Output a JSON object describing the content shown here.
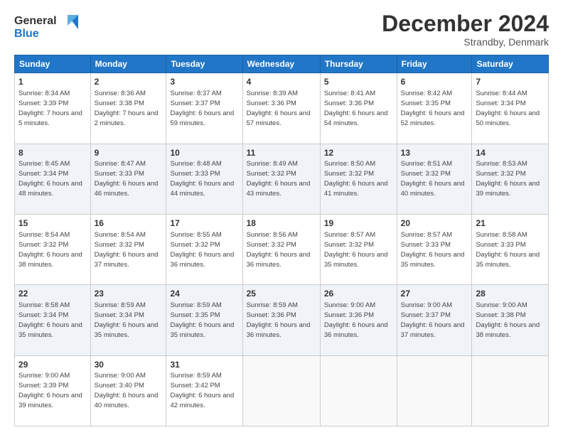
{
  "logo": {
    "line1": "General",
    "line2": "Blue",
    "icon_color": "#2176c7"
  },
  "header": {
    "month": "December 2024",
    "location": "Strandby, Denmark"
  },
  "columns": [
    "Sunday",
    "Monday",
    "Tuesday",
    "Wednesday",
    "Thursday",
    "Friday",
    "Saturday"
  ],
  "weeks": [
    [
      {
        "day": "1",
        "sunrise": "8:34 AM",
        "sunset": "3:39 PM",
        "daylight": "7 hours and 5 minutes."
      },
      {
        "day": "2",
        "sunrise": "8:36 AM",
        "sunset": "3:38 PM",
        "daylight": "7 hours and 2 minutes."
      },
      {
        "day": "3",
        "sunrise": "8:37 AM",
        "sunset": "3:37 PM",
        "daylight": "6 hours and 59 minutes."
      },
      {
        "day": "4",
        "sunrise": "8:39 AM",
        "sunset": "3:36 PM",
        "daylight": "6 hours and 57 minutes."
      },
      {
        "day": "5",
        "sunrise": "8:41 AM",
        "sunset": "3:36 PM",
        "daylight": "6 hours and 54 minutes."
      },
      {
        "day": "6",
        "sunrise": "8:42 AM",
        "sunset": "3:35 PM",
        "daylight": "6 hours and 52 minutes."
      },
      {
        "day": "7",
        "sunrise": "8:44 AM",
        "sunset": "3:34 PM",
        "daylight": "6 hours and 50 minutes."
      }
    ],
    [
      {
        "day": "8",
        "sunrise": "8:45 AM",
        "sunset": "3:34 PM",
        "daylight": "6 hours and 48 minutes."
      },
      {
        "day": "9",
        "sunrise": "8:47 AM",
        "sunset": "3:33 PM",
        "daylight": "6 hours and 46 minutes."
      },
      {
        "day": "10",
        "sunrise": "8:48 AM",
        "sunset": "3:33 PM",
        "daylight": "6 hours and 44 minutes."
      },
      {
        "day": "11",
        "sunrise": "8:49 AM",
        "sunset": "3:32 PM",
        "daylight": "6 hours and 43 minutes."
      },
      {
        "day": "12",
        "sunrise": "8:50 AM",
        "sunset": "3:32 PM",
        "daylight": "6 hours and 41 minutes."
      },
      {
        "day": "13",
        "sunrise": "8:51 AM",
        "sunset": "3:32 PM",
        "daylight": "6 hours and 40 minutes."
      },
      {
        "day": "14",
        "sunrise": "8:53 AM",
        "sunset": "3:32 PM",
        "daylight": "6 hours and 39 minutes."
      }
    ],
    [
      {
        "day": "15",
        "sunrise": "8:54 AM",
        "sunset": "3:32 PM",
        "daylight": "6 hours and 38 minutes."
      },
      {
        "day": "16",
        "sunrise": "8:54 AM",
        "sunset": "3:32 PM",
        "daylight": "6 hours and 37 minutes."
      },
      {
        "day": "17",
        "sunrise": "8:55 AM",
        "sunset": "3:32 PM",
        "daylight": "6 hours and 36 minutes."
      },
      {
        "day": "18",
        "sunrise": "8:56 AM",
        "sunset": "3:32 PM",
        "daylight": "6 hours and 36 minutes."
      },
      {
        "day": "19",
        "sunrise": "8:57 AM",
        "sunset": "3:32 PM",
        "daylight": "6 hours and 35 minutes."
      },
      {
        "day": "20",
        "sunrise": "8:57 AM",
        "sunset": "3:33 PM",
        "daylight": "6 hours and 35 minutes."
      },
      {
        "day": "21",
        "sunrise": "8:58 AM",
        "sunset": "3:33 PM",
        "daylight": "6 hours and 35 minutes."
      }
    ],
    [
      {
        "day": "22",
        "sunrise": "8:58 AM",
        "sunset": "3:34 PM",
        "daylight": "6 hours and 35 minutes."
      },
      {
        "day": "23",
        "sunrise": "8:59 AM",
        "sunset": "3:34 PM",
        "daylight": "6 hours and 35 minutes."
      },
      {
        "day": "24",
        "sunrise": "8:59 AM",
        "sunset": "3:35 PM",
        "daylight": "6 hours and 35 minutes."
      },
      {
        "day": "25",
        "sunrise": "8:59 AM",
        "sunset": "3:36 PM",
        "daylight": "6 hours and 36 minutes."
      },
      {
        "day": "26",
        "sunrise": "9:00 AM",
        "sunset": "3:36 PM",
        "daylight": "6 hours and 36 minutes."
      },
      {
        "day": "27",
        "sunrise": "9:00 AM",
        "sunset": "3:37 PM",
        "daylight": "6 hours and 37 minutes."
      },
      {
        "day": "28",
        "sunrise": "9:00 AM",
        "sunset": "3:38 PM",
        "daylight": "6 hours and 38 minutes."
      }
    ],
    [
      {
        "day": "29",
        "sunrise": "9:00 AM",
        "sunset": "3:39 PM",
        "daylight": "6 hours and 39 minutes."
      },
      {
        "day": "30",
        "sunrise": "9:00 AM",
        "sunset": "3:40 PM",
        "daylight": "6 hours and 40 minutes."
      },
      {
        "day": "31",
        "sunrise": "8:59 AM",
        "sunset": "3:42 PM",
        "daylight": "6 hours and 42 minutes."
      },
      null,
      null,
      null,
      null
    ]
  ],
  "labels": {
    "sunrise": "Sunrise:",
    "sunset": "Sunset:",
    "daylight": "Daylight:"
  }
}
